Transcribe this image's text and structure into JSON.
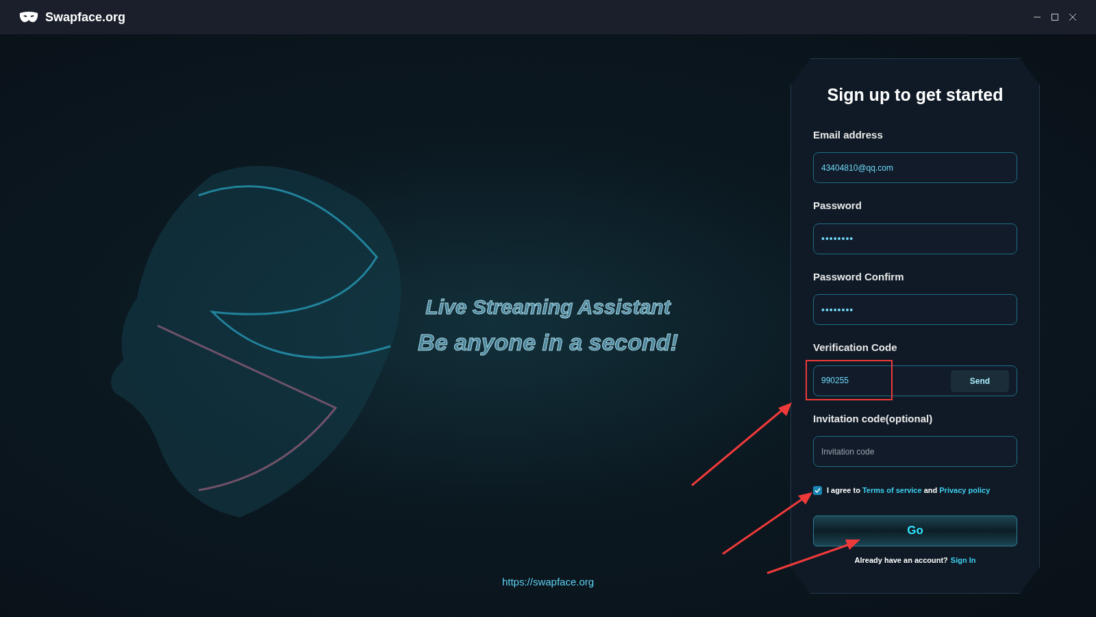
{
  "window": {
    "title": "Swapface.org"
  },
  "hero": {
    "lines": [
      "Live Streaming Assistant",
      "Be anyone in a second!"
    ],
    "url": "https://swapface.org"
  },
  "form": {
    "title": "Sign up to get started",
    "fields": [
      {
        "label": "Email address",
        "kind": "text",
        "value": "43404810@qq.com"
      },
      {
        "label": "Password",
        "kind": "password",
        "value": "••••••••"
      },
      {
        "label": "Password Confirm",
        "kind": "password",
        "value": "••••••••"
      },
      {
        "label": "Verification Code",
        "kind": "code",
        "value": "990255",
        "button": "Send"
      },
      {
        "label": "Invitation code(optional)",
        "kind": "text",
        "placeholder": "Invitation code"
      }
    ],
    "agree": {
      "checked": true,
      "text_before": "I agree to",
      "terms": "Terms of service",
      "text_between": "and",
      "privacy": "Privacy policy"
    },
    "submit": "Go",
    "footer": {
      "text": "Already have an account?",
      "link": "Sign In"
    }
  }
}
